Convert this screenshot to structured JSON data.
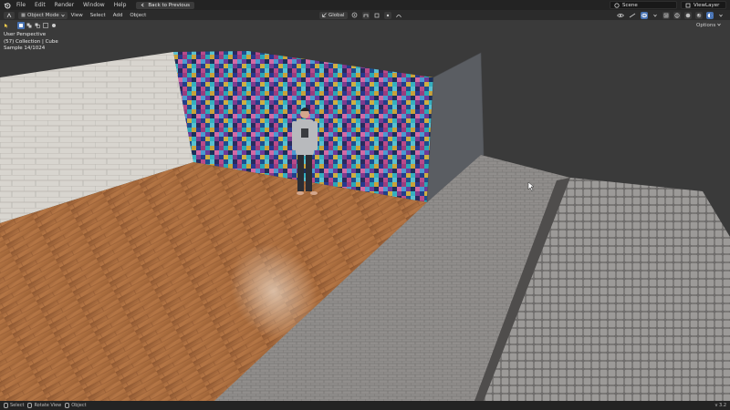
{
  "topbar": {
    "menus": [
      "File",
      "Edit",
      "Render",
      "Window",
      "Help"
    ],
    "back_button": "Back to Previous",
    "scene": "Scene",
    "view_layer": "ViewLayer"
  },
  "header": {
    "mode": "Object Mode",
    "menus": [
      "View",
      "Select",
      "Add",
      "Object"
    ],
    "orientation": "Global"
  },
  "viewport": {
    "perspective": "User Perspective",
    "collection": "(57) Collection | Cube",
    "sample": "Sample 14/1024",
    "options": "Options"
  },
  "statusbar": {
    "select": "Select",
    "rotate": "Rotate View",
    "object": "Object",
    "version": "v 3.2"
  },
  "colors": {
    "accent": "#4772b3",
    "floor_wood": "#a9683a",
    "wall": "#d9d6d0",
    "pavement": "#8f8c8a"
  }
}
